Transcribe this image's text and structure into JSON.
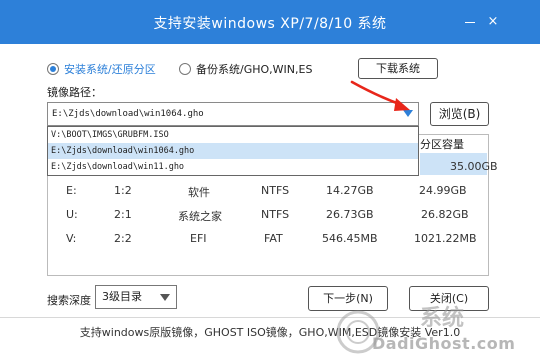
{
  "window": {
    "title": "支持安装windows XP/7/8/10 系统",
    "close_glyph": "×"
  },
  "mode": {
    "install_label": "安装系统/还原分区",
    "backup_label": "备份系统/GHO,WIN,ES",
    "download_button": "下载系统"
  },
  "image_path": {
    "label": "镜像路径：",
    "value": "E:\\Zjds\\download\\win1064.gho",
    "browse_button": "浏览(B)",
    "options": [
      "V:\\BOOT\\IMGS\\GRUBFM.ISO",
      "E:\\Zjds\\download\\win1064.gho",
      "E:\\Zjds\\download\\win11.gho"
    ],
    "selected_index": 1
  },
  "partition_table": {
    "visible_header": "分区容量",
    "rows": [
      {
        "drive": "",
        "index": "",
        "label": "",
        "fs": "",
        "free": "",
        "capacity": "35.00GB"
      },
      {
        "drive": "E:",
        "index": "1:2",
        "label": "软件",
        "fs": "NTFS",
        "free": "14.27GB",
        "capacity": "24.99GB"
      },
      {
        "drive": "U:",
        "index": "2:1",
        "label": "系统之家",
        "fs": "NTFS",
        "free": "26.73GB",
        "capacity": "26.82GB"
      },
      {
        "drive": "V:",
        "index": "2:2",
        "label": "EFI",
        "fs": "FAT",
        "free": "546.45MB",
        "capacity": "1021.22MB"
      }
    ]
  },
  "search": {
    "label": "搜索深度",
    "value": "3级目录"
  },
  "actions": {
    "next_button": "下一步(N)",
    "close_button": "关闭(C)"
  },
  "footer": {
    "text": "支持windows原版镜像，GHOST ISO镜像，GHO,WIM,ESD镜像安装 Ver1.0"
  },
  "watermark": {
    "text": "系统",
    "site": "DadiGhost.com"
  },
  "colors": {
    "accent": "#2d80d9",
    "selected_row": "#cde3f7",
    "annotation_arrow": "#e8261a"
  }
}
